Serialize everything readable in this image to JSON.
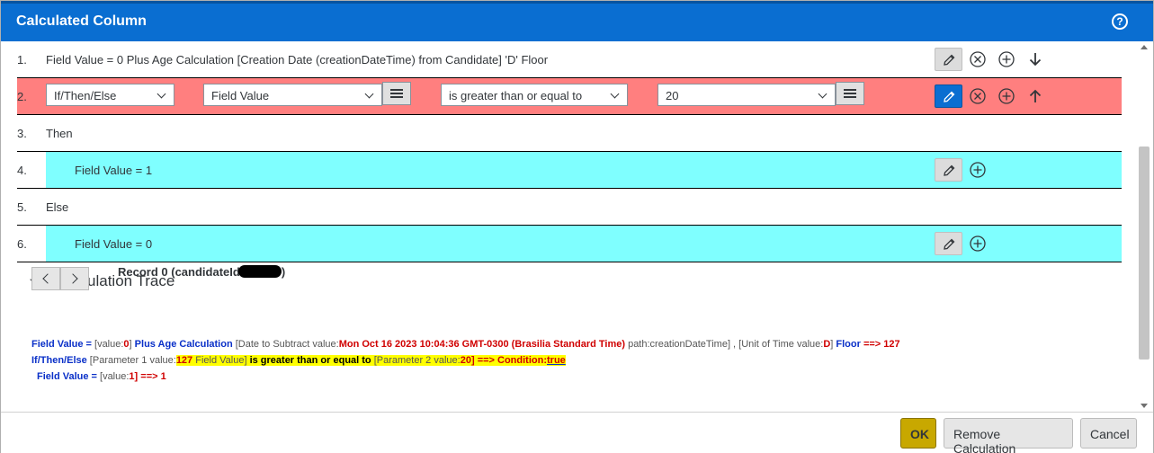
{
  "dialog": {
    "title": "Calculated Column",
    "help_icon": "help-circle-icon",
    "help_glyph": "?"
  },
  "rows": [
    {
      "num": "1.",
      "text": "Field Value = 0 Plus Age Calculation [Creation Date (creationDateTime) from Candidate] 'D' Floor"
    },
    {
      "num": "2.",
      "if_select": "If/Then/Else",
      "field_select": "Field Value",
      "operator_select": "is greater than or equal to",
      "value_select": "20"
    },
    {
      "num": "3.",
      "text": "Then"
    },
    {
      "num": "4.",
      "text": "Field Value = 1"
    },
    {
      "num": "5.",
      "text": "Else"
    },
    {
      "num": "6.",
      "text": "Field Value = 0"
    }
  ],
  "trace": {
    "header": "Calculation Trace",
    "record_label": "Record 0 (candidateId",
    "record_close": ")",
    "line1": {
      "a": "Field Value =",
      "b": " [value:",
      "c": "0",
      "d": "] ",
      "e": "Plus Age Calculation",
      "f": " [Date to Subtract value:",
      "g": "Mon Oct 16 2023 10:04:36 GMT-0300 (Brasilia Standard Time)",
      "h": " path:creationDateTime] , [Unit of Time value:",
      "i": "D",
      "j": "] ",
      "k": "Floor",
      "l": " ==> 127"
    },
    "line2": {
      "a": "If/Then/Else",
      "b": " [Parameter 1 value:",
      "c": "127",
      "d": " Field Value] ",
      "e": "is greater than or equal to",
      "f": " [Parameter 2 value:",
      "g": "20",
      "h": "] ==> Condition:",
      "i": "true"
    },
    "line3": {
      "a": "Field Value =",
      "b": " [value:",
      "c": "1",
      "d": "] ==> 1"
    }
  },
  "footer": {
    "ok": "OK",
    "remove": "Remove Calculation",
    "cancel": "Cancel"
  },
  "colors": {
    "header": "#0a6ed1",
    "row_active": "#ff7f7f",
    "row_nested": "#7fffff",
    "ok_button": "#c8a800",
    "highlight": "#ffff00"
  }
}
